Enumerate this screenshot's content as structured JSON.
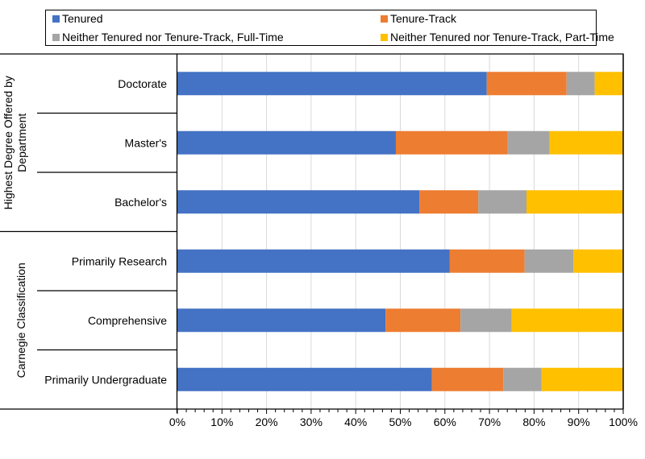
{
  "chart_data": {
    "type": "bar",
    "orientation": "horizontal",
    "stacked": true,
    "percent_stacked": true,
    "title": "",
    "xlabel": "",
    "ylabel": "",
    "xlim": [
      0,
      100
    ],
    "x_ticks": [
      "0%",
      "10%",
      "20%",
      "30%",
      "40%",
      "50%",
      "60%",
      "70%",
      "80%",
      "90%",
      "100%"
    ],
    "grid": "vertical",
    "legend_position": "top",
    "groups": [
      {
        "label": "Highest Degree Offered by Department",
        "label_lines": [
          "Highest Degree Offered by",
          "Department"
        ],
        "categories": [
          "Doctorate",
          "Master's",
          "Bachelor's"
        ]
      },
      {
        "label": "Carnegie Classification",
        "label_lines": [
          "Carnegie Classification"
        ],
        "categories": [
          "Primarily Research",
          "Comprehensive",
          "Primarily Undergraduate"
        ]
      }
    ],
    "categories": [
      "Doctorate",
      "Master's",
      "Bachelor's",
      "Primarily Research",
      "Comprehensive",
      "Primarily Undergraduate"
    ],
    "series": [
      {
        "name": "Tenured",
        "color": "#4472C4",
        "values": [
          69.4,
          49.0,
          54.3,
          61.1,
          46.7,
          57.1
        ]
      },
      {
        "name": "Tenure-Track",
        "color": "#ED7D31",
        "values": [
          17.9,
          25.1,
          13.2,
          16.8,
          16.8,
          16.0
        ]
      },
      {
        "name": "Neither Tenured nor Tenure-Track, Full-Time",
        "color": "#A5A5A5",
        "values": [
          6.3,
          9.4,
          10.8,
          10.9,
          11.5,
          8.6
        ]
      },
      {
        "name": "Neither Tenured nor Tenure-Track, Part-Time",
        "color": "#FFC000",
        "values": [
          6.4,
          16.5,
          21.7,
          11.2,
          25.0,
          18.3
        ]
      }
    ]
  },
  "legend": {
    "items": [
      {
        "label": "Tenured",
        "color": "#4472C4"
      },
      {
        "label": "Tenure-Track",
        "color": "#ED7D31"
      },
      {
        "label": "Neither Tenured nor Tenure-Track, Full-Time",
        "color": "#A5A5A5"
      },
      {
        "label": "Neither Tenured nor Tenure-Track, Part-Time",
        "color": "#FFC000"
      }
    ]
  }
}
